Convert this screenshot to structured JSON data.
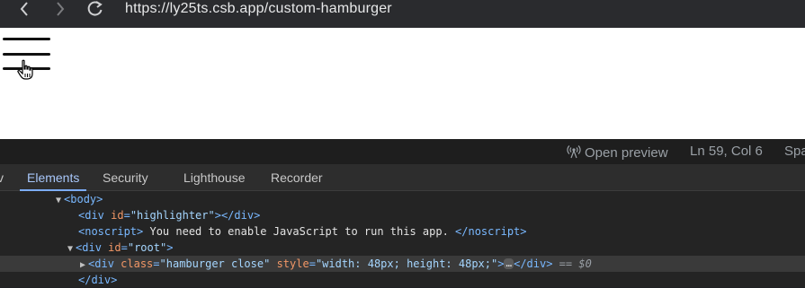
{
  "browser": {
    "url": "https://ly25ts.csb.app/custom-hamburger",
    "back_icon": "chevron-left-icon",
    "forward_icon": "chevron-right-icon",
    "reload_icon": "reload-icon"
  },
  "statusbar": {
    "open_preview": "Open preview",
    "cursor_position": "Ln 59, Col 6",
    "partial": "Spa"
  },
  "devtools": {
    "tabs": {
      "partial": "v",
      "elements": "Elements",
      "security": "Security",
      "lighthouse": "Lighthouse",
      "recorder": "Recorder"
    },
    "tree": {
      "body_open": "<body>",
      "highlighter": {
        "open": "<div ",
        "attr": "id",
        "eq": "=",
        "val": "\"highlighter\"",
        "close": "></div>"
      },
      "noscript": {
        "open": "<noscript>",
        "text": " You need to enable JavaScript to run this app. ",
        "close": "</noscript>"
      },
      "root": {
        "open": "<div ",
        "attr": "id",
        "eq": "=",
        "val": "\"root\"",
        "close": ">"
      },
      "hamburger": {
        "open": "<div ",
        "attr1": "class",
        "val1": "\"hamburger close\"",
        "attr2": "style",
        "val2": "\"width: 48px; height: 48px;\"",
        "gt": ">",
        "ellipsis": "…",
        "close": "</div>",
        "eq_sel": " == ",
        "dollar": "$0"
      },
      "div_close": "</div>"
    }
  },
  "colors": {
    "accent_tab": "#a8c7fa",
    "tag": "#79b8ff",
    "attr": "#f29766",
    "value": "#a5d6ff"
  }
}
